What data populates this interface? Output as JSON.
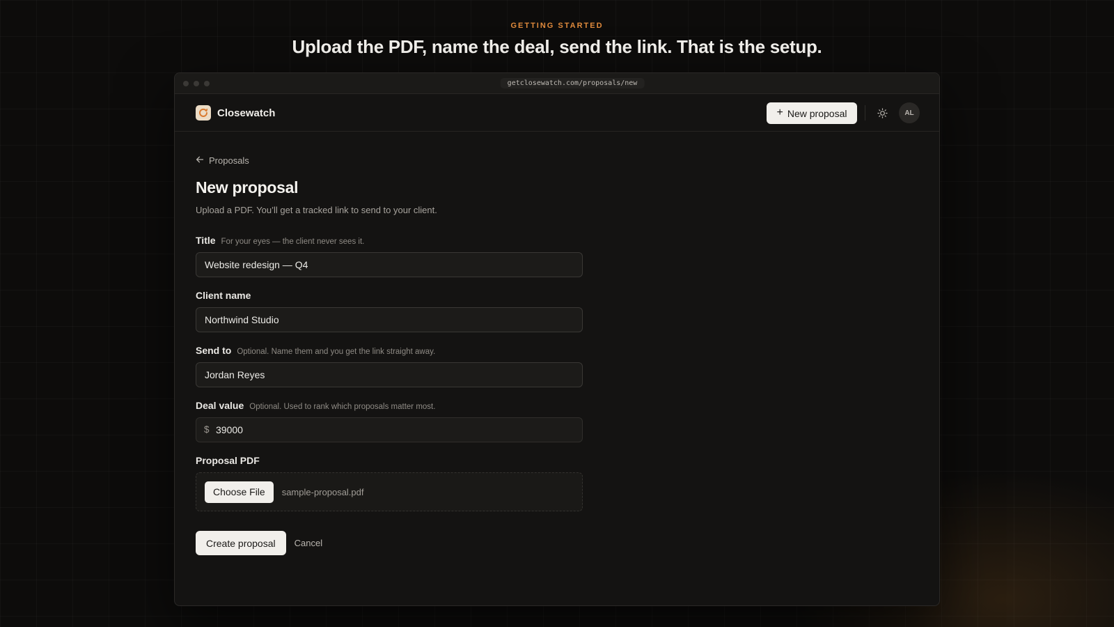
{
  "intro": {
    "eyebrow": "GETTING STARTED",
    "headline": "Upload the PDF, name the deal, send the link. That is the setup."
  },
  "browser": {
    "url": "getclosewatch.com/proposals/new"
  },
  "appbar": {
    "brand": "Closewatch",
    "new_button": "New proposal",
    "avatar_initials": "AL"
  },
  "page": {
    "back_link": "Proposals",
    "title": "New proposal",
    "subtitle": "Upload a PDF. You’ll get a tracked link to send to your client."
  },
  "form": {
    "title": {
      "label": "Title",
      "hint": "For your eyes — the client never sees it.",
      "value": "Website redesign — Q4"
    },
    "client_name": {
      "label": "Client name",
      "value": "Northwind Studio"
    },
    "send_to": {
      "label": "Send to",
      "hint": "Optional. Name them and you get the link straight away.",
      "value": "Jordan Reyes"
    },
    "deal_value": {
      "label": "Deal value",
      "hint": "Optional. Used to rank which proposals matter most.",
      "currency": "$",
      "value": "39000"
    },
    "pdf": {
      "label": "Proposal PDF",
      "choose_label": "Choose File",
      "file_name": "sample-proposal.pdf"
    },
    "submit_label": "Create proposal",
    "cancel_label": "Cancel"
  },
  "colors": {
    "accent": "#e08a3c",
    "background": "#0d0c0b",
    "panel": "#141312",
    "button_light": "#f1efeb"
  }
}
